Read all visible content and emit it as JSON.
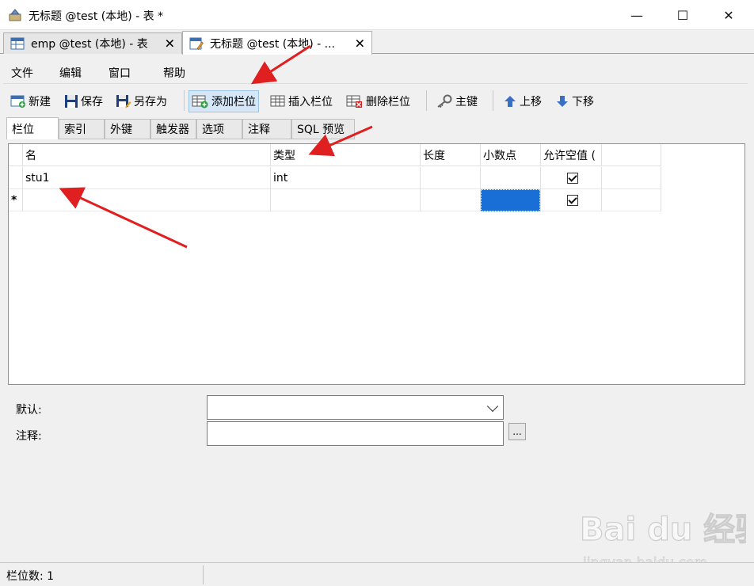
{
  "window": {
    "title": "无标题 @test (本地) - 表 *",
    "minimize_glyph": "—",
    "maximize_glyph": "☐",
    "close_glyph": "✕"
  },
  "doc_tabs": [
    {
      "label": "emp @test (本地) - 表",
      "close": "✕"
    },
    {
      "label": "无标题 @test (本地) - ...",
      "close": "✕"
    }
  ],
  "menu": [
    "文件",
    "编辑",
    "窗口",
    "帮助"
  ],
  "toolbar": {
    "new": "新建",
    "save": "保存",
    "save_as": "另存为",
    "add_field": "添加栏位",
    "insert_field": "插入栏位",
    "delete_field": "删除栏位",
    "primary_key": "主键",
    "move_up": "上移",
    "move_down": "下移"
  },
  "prop_tabs": [
    "栏位",
    "索引",
    "外键",
    "触发器",
    "选项",
    "注释",
    "SQL 预览"
  ],
  "grid": {
    "columns": [
      "名",
      "类型",
      "长度",
      "小数点",
      "允许空值 (",
      ""
    ],
    "rows": [
      {
        "marker": "",
        "name": "stu1",
        "type": "int",
        "length": "",
        "decimals": "",
        "allow_null": true
      },
      {
        "marker": "*",
        "name": "",
        "type": "",
        "length": "",
        "decimals": "",
        "allow_null": true
      }
    ]
  },
  "form": {
    "default_label": "默认:",
    "comment_label": "注释:",
    "ellipsis": "..."
  },
  "status": {
    "field_count": "栏位数: 1"
  },
  "watermark": {
    "brand": "Bai du 经验",
    "url": "jingyan.baidu.com"
  },
  "colors": {
    "selection": "#1a6fd6",
    "highlight": "#d5e6f7",
    "arrow": "#e02020"
  }
}
